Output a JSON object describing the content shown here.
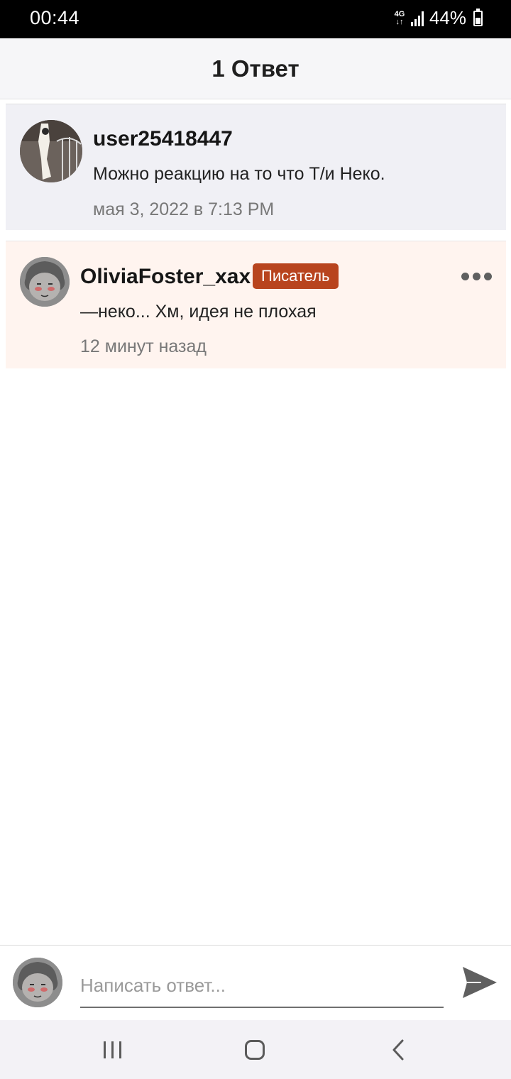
{
  "status_bar": {
    "time": "00:44",
    "network_type": "4G",
    "battery": "44%"
  },
  "header": {
    "title": "1 Ответ"
  },
  "comments": [
    {
      "username": "user25418447",
      "text": "Можно реакцию на то что Т/и Неко.",
      "time": "мая 3, 2022 в 7:13 PM"
    },
    {
      "username": "OliviaFoster_xax",
      "badge": "Писатель",
      "text": "—неко... Хм, идея не плохая",
      "time": "12 минут назад"
    }
  ],
  "reply_bar": {
    "placeholder": "Написать ответ..."
  },
  "colors": {
    "badge": "#b8441e",
    "reply_highlight": "#fff4ef",
    "comment_bg": "#f0f0f5"
  },
  "icons": {
    "more": "more-dots-icon",
    "send": "send-icon",
    "nav": [
      "recent-apps-icon",
      "home-icon",
      "back-icon"
    ]
  }
}
